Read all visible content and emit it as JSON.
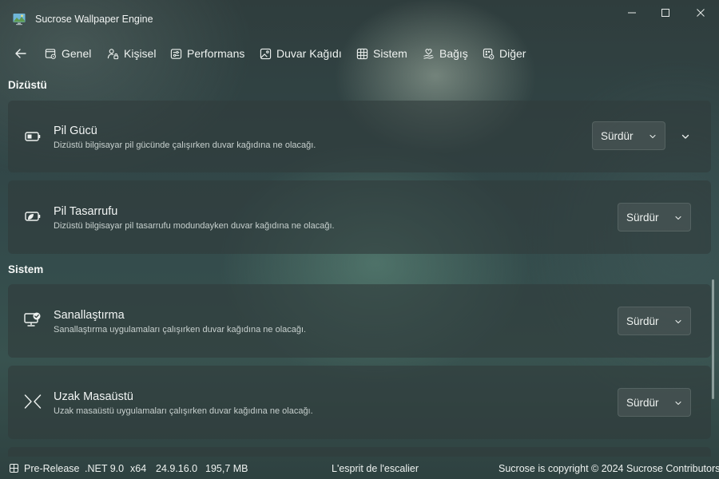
{
  "window": {
    "title": "Sucrose Wallpaper Engine",
    "app_icon": "monitor-landscape-icon",
    "controls": [
      "minimize-icon",
      "maximize-icon",
      "close-icon"
    ]
  },
  "nav": {
    "back_icon": "arrow-left-icon",
    "items": [
      {
        "label": "Genel",
        "icon": "window-settings-icon"
      },
      {
        "label": "Kişisel",
        "icon": "person-lock-icon"
      },
      {
        "label": "Performans",
        "icon": "gauge-panel-icon"
      },
      {
        "label": "Duvar Kağıdı",
        "icon": "image-icon"
      },
      {
        "label": "Sistem",
        "icon": "grid-icon"
      },
      {
        "label": "Bağış",
        "icon": "heart-hand-icon"
      },
      {
        "label": "Diğer",
        "icon": "app-settings-icon"
      }
    ]
  },
  "sections": [
    {
      "title": "Dizüstü",
      "cards": [
        {
          "title": "Pil Gücü",
          "description": "Dizüstü bilgisayar pil gücünde çalışırken duvar kağıdına ne olacağı.",
          "value": "Sürdür",
          "icon": "battery-icon",
          "expandable": true
        },
        {
          "title": "Pil Tasarrufu",
          "description": "Dizüstü bilgisayar pil tasarrufu modundayken duvar kağıdına ne olacağı.",
          "value": "Sürdür",
          "icon": "battery-saver-icon",
          "expandable": false
        }
      ]
    },
    {
      "title": "Sistem",
      "cards": [
        {
          "title": "Sanallaştırma",
          "description": "Sanallaştırma uygulamaları çalışırken duvar kağıdına ne olacağı.",
          "value": "Sürdür",
          "icon": "desktop-check-icon",
          "expandable": false
        },
        {
          "title": "Uzak Masaüstü",
          "description": "Uzak masaüstü uygulamaları çalışırken duvar kağıdına ne olacağı.",
          "value": "Sürdür",
          "icon": "remote-desktop-icon",
          "expandable": false
        }
      ]
    }
  ],
  "statusbar": {
    "icon": "build-grid-icon",
    "channel": "Pre-Release",
    "framework": ".NET 9.0",
    "arch": "x64",
    "version": "24.9.16.0",
    "memory": "195,7 MB",
    "quote": "L'esprit de l'escalier",
    "copyright": "Sucrose is copyright © 2024 Sucrose Contributors"
  }
}
